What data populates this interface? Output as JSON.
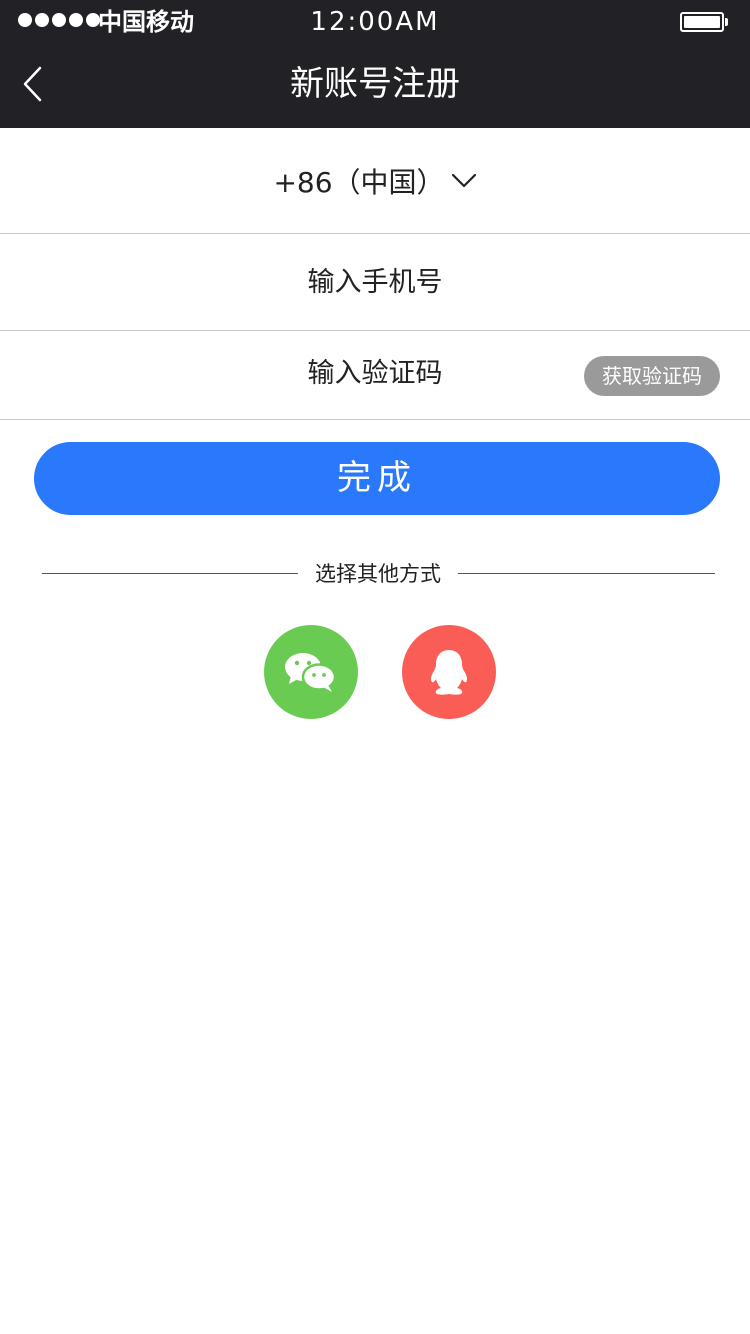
{
  "status_bar": {
    "carrier": "中国移动",
    "time": "12:00AM",
    "signal_dots": 5
  },
  "nav": {
    "title": "新账号注册",
    "back_icon": "chevron-left-icon"
  },
  "form": {
    "country_code": "+86（中国）",
    "country_icon": "chevron-down-icon",
    "phone_placeholder": "输入手机号",
    "code_placeholder": "输入验证码",
    "get_code_label": "获取验证码",
    "submit_label": "完成"
  },
  "alt_login": {
    "label": "选择其他方式",
    "options": [
      {
        "icon": "wechat-icon",
        "color": "#6acb53"
      },
      {
        "icon": "qq-icon",
        "color": "#fa5c56"
      }
    ]
  },
  "colors": {
    "header_bg": "#222226",
    "accent": "#2a78fb",
    "get_code_bg": "#9a9a9a"
  }
}
